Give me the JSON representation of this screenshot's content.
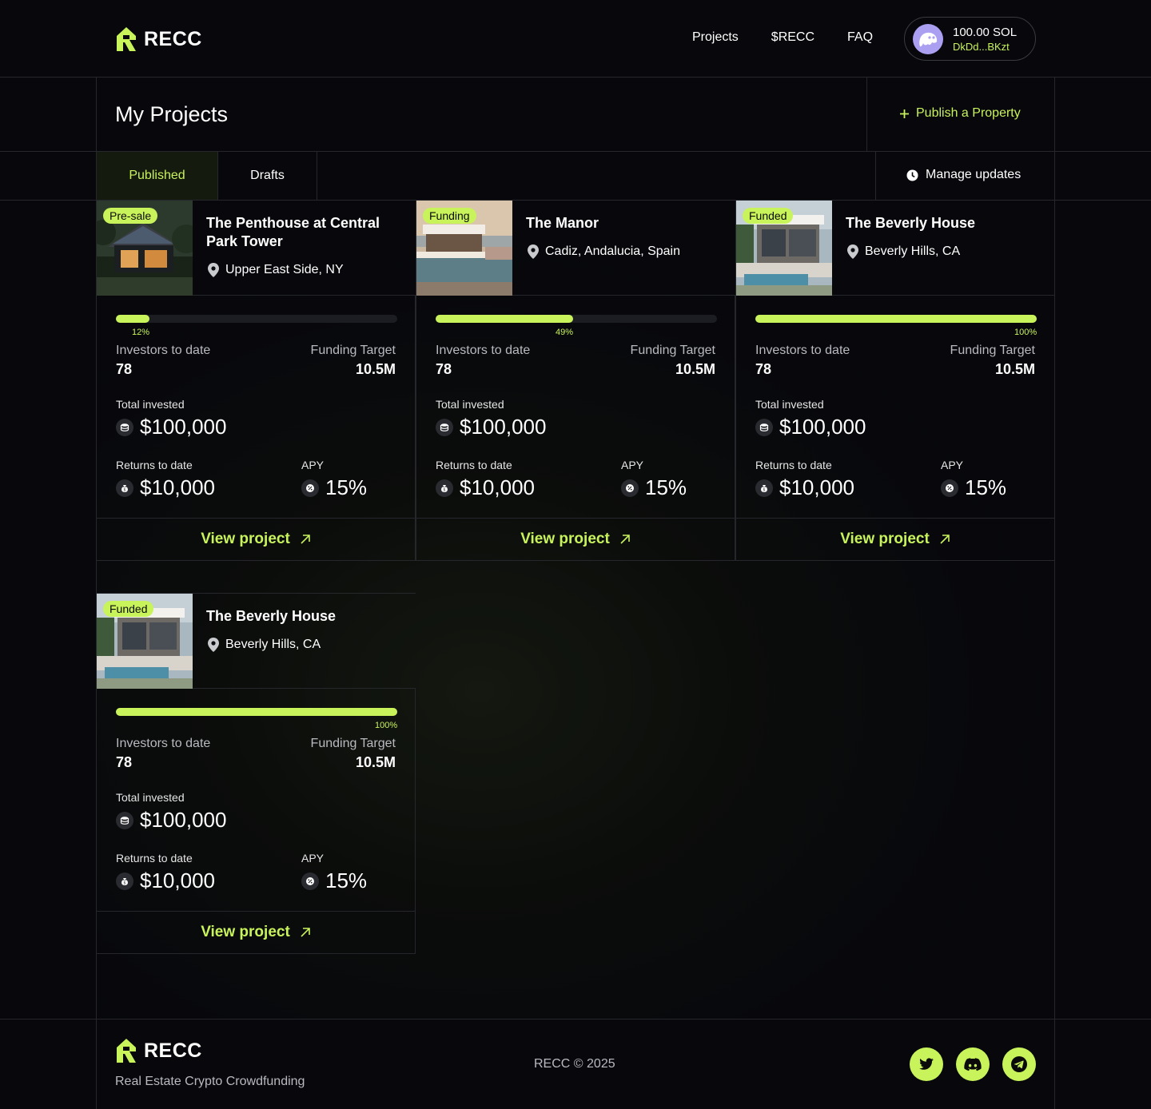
{
  "header": {
    "logo": "RECC",
    "nav": [
      "Projects",
      "$RECC",
      "FAQ"
    ],
    "wallet": {
      "balance": "100.00 SOL",
      "address": "DkDd...BKzt"
    }
  },
  "page": {
    "title": "My Projects",
    "publish_label": "Publish a Property",
    "tabs": [
      "Published",
      "Drafts"
    ],
    "manage_label": "Manage updates"
  },
  "labels": {
    "investors": "Investors to date",
    "target": "Funding Target",
    "total": "Total invested",
    "returns": "Returns to date",
    "apy": "APY",
    "view": "View project"
  },
  "projects": [
    {
      "badge": "Pre-sale",
      "title": "The Penthouse at Central Park Tower",
      "location": "Upper East Side, NY",
      "progress": 12,
      "progress_label": "12%",
      "investors": "78",
      "target": "10.5M",
      "total": "$100,000",
      "returns": "$10,000",
      "apy": "15%"
    },
    {
      "badge": "Funding",
      "title": "The Manor",
      "location": "Cadiz, Andalucia, Spain",
      "progress": 49,
      "progress_label": "49%",
      "investors": "78",
      "target": "10.5M",
      "total": "$100,000",
      "returns": "$10,000",
      "apy": "15%"
    },
    {
      "badge": "Funded",
      "title": "The Beverly House",
      "location": "Beverly Hills, CA",
      "progress": 100,
      "progress_label": "100%",
      "investors": "78",
      "target": "10.5M",
      "total": "$100,000",
      "returns": "$10,000",
      "apy": "15%"
    },
    {
      "badge": "Funded",
      "title": "The Beverly House",
      "location": "Beverly Hills, CA",
      "progress": 100,
      "progress_label": "100%",
      "investors": "78",
      "target": "10.5M",
      "total": "$100,000",
      "returns": "$10,000",
      "apy": "15%"
    }
  ],
  "footer": {
    "logo": "RECC",
    "tagline": "Real Estate Crypto Crowdfunding",
    "copyright": "RECC © 2025"
  },
  "colors": {
    "accent": "#c8f35b",
    "background": "#07070c",
    "line": "#26272c"
  }
}
